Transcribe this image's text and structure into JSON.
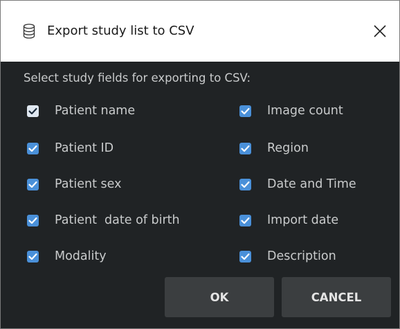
{
  "window": {
    "title": "Export study list to CSV",
    "icon": "database-icon",
    "close_icon": "close-icon"
  },
  "dialog": {
    "instruction": "Select study fields for exporting to CSV:",
    "fields_left": [
      {
        "label": "Patient name",
        "checked": true
      },
      {
        "label": "Patient ID",
        "checked": true
      },
      {
        "label": "Patient sex",
        "checked": true
      },
      {
        "label": "Patient  date of birth",
        "checked": true
      },
      {
        "label": "Modality",
        "checked": true
      }
    ],
    "fields_right": [
      {
        "label": "Image count",
        "checked": true
      },
      {
        "label": "Region",
        "checked": true
      },
      {
        "label": "Date and Time",
        "checked": true
      },
      {
        "label": "Import date",
        "checked": true
      },
      {
        "label": "Description",
        "checked": true
      }
    ],
    "ok_label": "OK",
    "cancel_label": "CANCEL"
  },
  "colors": {
    "background": "#202325",
    "titlebar": "#ffffff",
    "checkbox_accent": "#4a90d9",
    "button": "#3b3e40",
    "text": "#c9cbcc"
  }
}
